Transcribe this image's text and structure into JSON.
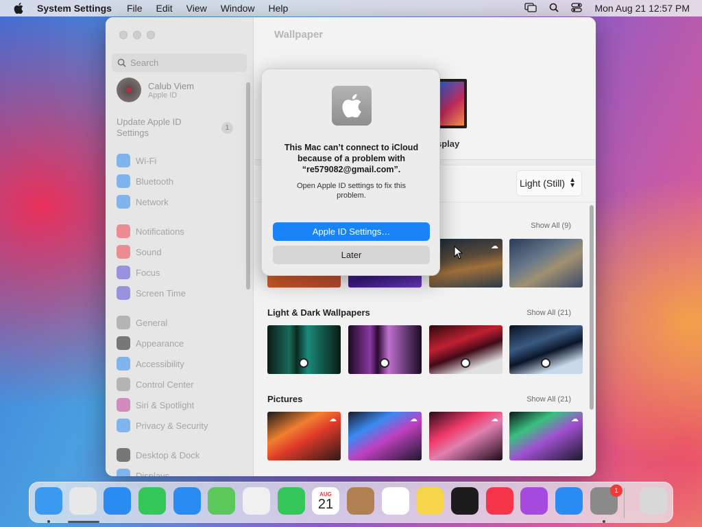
{
  "menubar": {
    "app_name": "System Settings",
    "items": [
      "File",
      "Edit",
      "View",
      "Window",
      "Help"
    ],
    "datetime": "Mon Aug 21  12:57 PM"
  },
  "sidebar": {
    "search_placeholder": "Search",
    "account_name": "Calub Viem",
    "account_sub": "Apple ID",
    "update_label": "Update Apple ID Settings",
    "update_badge": "1",
    "items": [
      {
        "label": "Wi-Fi",
        "icon": "wifi-icon",
        "color": "#2a8bf2"
      },
      {
        "label": "Bluetooth",
        "icon": "bluetooth-icon",
        "color": "#2a8bf2"
      },
      {
        "label": "Network",
        "icon": "globe-icon",
        "color": "#2a8bf2"
      },
      {
        "label": "Notifications",
        "icon": "bell-icon",
        "color": "#f0424a"
      },
      {
        "label": "Sound",
        "icon": "speaker-icon",
        "color": "#f0424a"
      },
      {
        "label": "Focus",
        "icon": "moon-icon",
        "color": "#5a4ed8"
      },
      {
        "label": "Screen Time",
        "icon": "hourglass-icon",
        "color": "#5a4ed8"
      },
      {
        "label": "General",
        "icon": "gear-icon",
        "color": "#8a8a8a"
      },
      {
        "label": "Appearance",
        "icon": "appearance-icon",
        "color": "#1c1c1c"
      },
      {
        "label": "Accessibility",
        "icon": "accessibility-icon",
        "color": "#2a8bf2"
      },
      {
        "label": "Control Center",
        "icon": "control-center-icon",
        "color": "#8a8a8a"
      },
      {
        "label": "Siri & Spotlight",
        "icon": "siri-icon",
        "color": "#c0409a"
      },
      {
        "label": "Privacy & Security",
        "icon": "hand-icon",
        "color": "#2a8bf2"
      },
      {
        "label": "Desktop & Dock",
        "icon": "dock-icon",
        "color": "#1c1c1c"
      },
      {
        "label": "Displays",
        "icon": "display-icon",
        "color": "#2a8bf2"
      }
    ]
  },
  "content": {
    "title": "Wallpaper",
    "display_label": "splay",
    "appearance_select": "Light (Still)",
    "sections": [
      {
        "title": "",
        "show_all": "Show All (9)"
      },
      {
        "title": "Light & Dark Wallpapers",
        "show_all": "Show All (21)"
      },
      {
        "title": "Pictures",
        "show_all": "Show All (21)"
      }
    ]
  },
  "dialog": {
    "title": "This Mac can’t connect to iCloud because of a problem with “re579082@gmail.com”.",
    "message": "Open Apple ID settings to fix this problem.",
    "primary_button": "Apple ID Settings…",
    "secondary_button": "Later"
  },
  "dock": {
    "calendar_month": "AUG",
    "calendar_day": "21",
    "settings_badge": "1",
    "apps": [
      {
        "name": "finder-icon",
        "color": "#3a9af0"
      },
      {
        "name": "launchpad-icon",
        "color": "#e8e8e8"
      },
      {
        "name": "safari-icon",
        "color": "#2a8bf2"
      },
      {
        "name": "messages-icon",
        "color": "#35c759"
      },
      {
        "name": "mail-icon",
        "color": "#2a8bf2"
      },
      {
        "name": "maps-icon",
        "color": "#5ac85a"
      },
      {
        "name": "photos-icon",
        "color": "#f0f0f0"
      },
      {
        "name": "facetime-icon",
        "color": "#35c759"
      },
      {
        "name": "calendar-icon",
        "color": "#ffffff"
      },
      {
        "name": "contacts-icon",
        "color": "#b08050"
      },
      {
        "name": "reminders-icon",
        "color": "#ffffff"
      },
      {
        "name": "notes-icon",
        "color": "#f7d54a"
      },
      {
        "name": "tv-icon",
        "color": "#1c1c1c"
      },
      {
        "name": "music-icon",
        "color": "#f5364a"
      },
      {
        "name": "podcasts-icon",
        "color": "#a64ae0"
      },
      {
        "name": "app-store-icon",
        "color": "#2a8bf2"
      },
      {
        "name": "system-settings-icon",
        "color": "#8a8a8a"
      },
      {
        "name": "trash-icon",
        "color": "#d8d8d8"
      }
    ]
  }
}
